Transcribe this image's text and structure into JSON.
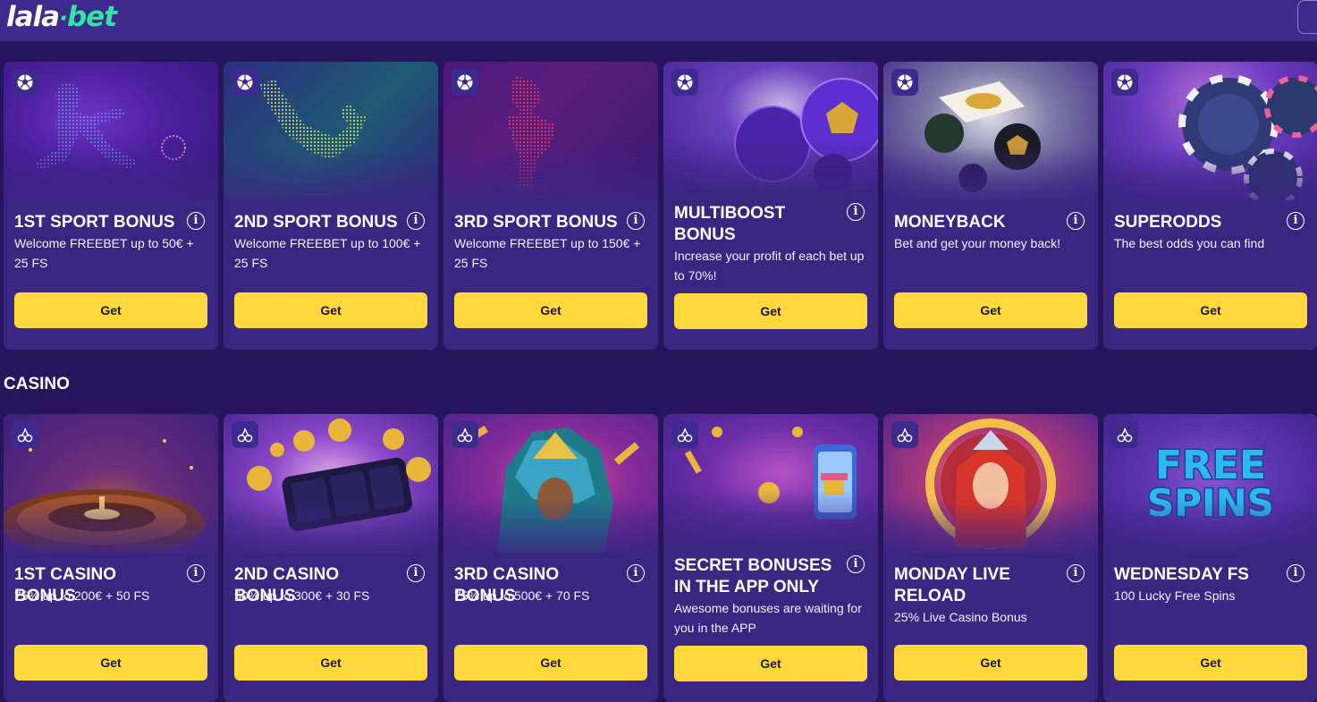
{
  "brand": {
    "logo_part1": "lala",
    "logo_dot": "·",
    "logo_part2": "bet"
  },
  "colors": {
    "accent_button": "#ffd93b",
    "brand_green": "#2ee6a6",
    "card_bg": "#3a2581",
    "page_bg": "#26155a"
  },
  "sport": {
    "cards": [
      {
        "title": "1ST SPORT BONUS",
        "desc": "Welcome FREEBET up to 50€ + 25 FS",
        "button": "Get",
        "icon": "soccer-ball-icon"
      },
      {
        "title": "2ND SPORT BONUS",
        "desc": "Welcome FREEBET up to 100€ + 25 FS",
        "button": "Get",
        "icon": "soccer-ball-icon"
      },
      {
        "title": "3RD SPORT BONUS",
        "desc": "Welcome FREEBET up to 150€ + 25 FS",
        "button": "Get",
        "icon": "soccer-ball-icon"
      },
      {
        "title": "MULTIBOOST BONUS",
        "desc": "Increase your profit of each bet up to 70%!",
        "button": "Get",
        "icon": "soccer-ball-icon"
      },
      {
        "title": "MONEYBACK",
        "desc": "Bet and get your money back!",
        "button": "Get",
        "icon": "soccer-ball-icon"
      },
      {
        "title": "SUPERODDS",
        "desc": "The best odds you can find",
        "button": "Get",
        "icon": "soccer-ball-icon"
      }
    ]
  },
  "casino": {
    "section_title": "CASINO",
    "cards": [
      {
        "title": "1ST CASINO BONUS",
        "desc": "75% up to 200€ + 50 FS",
        "button": "Get",
        "icon": "cherries-icon"
      },
      {
        "title": "2ND CASINO BONUS",
        "desc": "50% up to 300€ + 30 FS",
        "button": "Get",
        "icon": "cherries-icon"
      },
      {
        "title": "3RD CASINO BONUS",
        "desc": "75% up to 500€ + 70 FS",
        "button": "Get",
        "icon": "cherries-icon"
      },
      {
        "title": "SECRET BONUSES IN THE APP ONLY",
        "desc": "Awesome bonuses are waiting for you in the APP",
        "button": "Get",
        "icon": "cherries-icon"
      },
      {
        "title": "MONDAY LIVE RELOAD",
        "desc": "25% Live Casino Bonus",
        "button": "Get",
        "icon": "cherries-icon"
      },
      {
        "title": "WEDNESDAY FS",
        "desc": "100 Lucky Free Spins",
        "button": "Get",
        "icon": "cherries-icon"
      }
    ],
    "free_spins_art_text": [
      "FREE",
      "SPINS"
    ]
  }
}
